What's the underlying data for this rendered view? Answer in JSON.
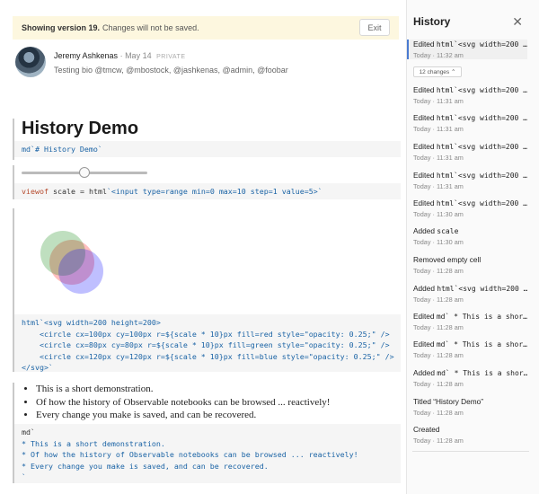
{
  "banner": {
    "version_text": "Showing version 19.",
    "note": "Changes will not be saved.",
    "exit_label": "Exit"
  },
  "author": {
    "name": "Jeremy Ashkenas",
    "date": "May 14",
    "visibility": "PRIVATE",
    "bio": "Testing bio @tmcw, @mbostock, @jashkenas, @admin, @foobar"
  },
  "notebook": {
    "title_output": "History Demo",
    "title_code": "md`# History Demo`",
    "slider_value": 5,
    "slider_min": 0,
    "slider_max": 10,
    "viewof_code": {
      "kw": "viewof",
      "name": " scale = ",
      "fn": "html",
      "str": "`<input type=range min=0 max=10 step=1 value=5>`"
    },
    "svg_code": {
      "line1": "html`<svg width=200 height=200>",
      "line2": "    <circle cx=100px cy=100px r=${scale * 10}px fill=red style=\"opacity: 0.25;\" />",
      "line3": "    <circle cx=80px cy=80px r=${scale * 10}px fill=green style=\"opacity: 0.25;\" />",
      "line4": "    <circle cx=120px cy=120px r=${scale * 10}px fill=blue style=\"opacity: 0.25;\" />",
      "line5": "</svg>`"
    },
    "bullets": [
      "This is a short demonstration.",
      "Of how the history of Observable notebooks can be browsed ... reactively!",
      "Every change you make is saved, and can be recovered."
    ],
    "md_code": {
      "line1": "md`",
      "line2": "* This is a short demonstration.",
      "line3": "* Of how the history of Observable notebooks can be browsed ... reactively!",
      "line4": "* Every change you make is saved, and can be recovered.",
      "line5": "`"
    },
    "circle_colors": [
      "#ff0000",
      "#008000",
      "#0000ff"
    ],
    "circle_opacity": 0.25
  },
  "history": {
    "title": "History",
    "changes_label": "12 changes ⌃",
    "items": [
      {
        "prefix": "Edited ",
        "code": "html`<svg width=200 …",
        "time": "Today · 11:32 am"
      },
      {
        "prefix": "Edited ",
        "code": "html`<svg width=200 …",
        "time": "Today · 11:31 am"
      },
      {
        "prefix": "Edited ",
        "code": "html`<svg width=200 …",
        "time": "Today · 11:31 am"
      },
      {
        "prefix": "Edited ",
        "code": "html`<svg width=200 …",
        "time": "Today · 11:31 am"
      },
      {
        "prefix": "Edited ",
        "code": "html`<svg width=200 …",
        "time": "Today · 11:31 am"
      },
      {
        "prefix": "Edited ",
        "code": "html`<svg width=200 …",
        "time": "Today · 11:30 am"
      },
      {
        "prefix": "Added ",
        "code": "scale",
        "time": "Today · 11:30 am"
      },
      {
        "prefix": "Removed empty cell",
        "code": "",
        "time": "Today · 11:28 am"
      },
      {
        "prefix": "Added ",
        "code": "html`<svg width=200 …",
        "time": "Today · 11:28 am"
      },
      {
        "prefix": "Edited ",
        "code": "md` * This is a shor…",
        "time": "Today · 11:28 am"
      },
      {
        "prefix": "Edited ",
        "code": "md` * This is a shor…",
        "time": "Today · 11:28 am"
      },
      {
        "prefix": "Added ",
        "code": "md` * This is a shor…",
        "time": "Today · 11:28 am"
      },
      {
        "prefix": "Titled “History Demo”",
        "code": "",
        "time": "Today · 11:28 am"
      },
      {
        "prefix": "Created",
        "code": "",
        "time": "Today · 11:28 am"
      }
    ]
  }
}
